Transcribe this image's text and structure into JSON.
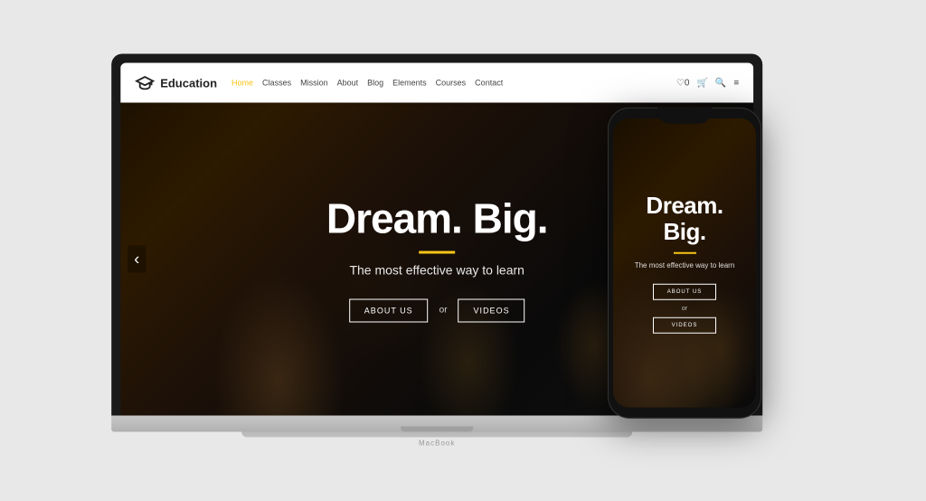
{
  "brand": {
    "name": "Education",
    "logo_alt": "graduation-cap"
  },
  "navbar": {
    "links": [
      {
        "label": "Home",
        "active": true,
        "has_dropdown": true
      },
      {
        "label": "Classes",
        "active": false,
        "has_dropdown": true
      },
      {
        "label": "Mission",
        "active": false,
        "has_dropdown": false
      },
      {
        "label": "About",
        "active": false,
        "has_dropdown": false
      },
      {
        "label": "Blog",
        "active": false,
        "has_dropdown": true
      },
      {
        "label": "Elements",
        "active": false,
        "has_dropdown": true
      },
      {
        "label": "Courses",
        "active": false,
        "has_dropdown": true
      },
      {
        "label": "Contact",
        "active": false,
        "has_dropdown": true
      }
    ],
    "icons": [
      "heart-count",
      "cart-icon",
      "search-icon",
      "menu-icon"
    ],
    "heart_count": "0"
  },
  "hero": {
    "title_line1": "Dream. Big.",
    "subtitle": "The most effective way to learn",
    "btn_about": "ABOUT US",
    "btn_or": "or",
    "btn_videos": "VIDEOS"
  },
  "laptop": {
    "brand_label": "MacBook"
  },
  "phone": {
    "title": "Dream. Big.",
    "subtitle": "The most effective way to learn",
    "btn_about": "ABOUT US",
    "btn_or": "or",
    "btn_videos": "VIDEOS"
  }
}
